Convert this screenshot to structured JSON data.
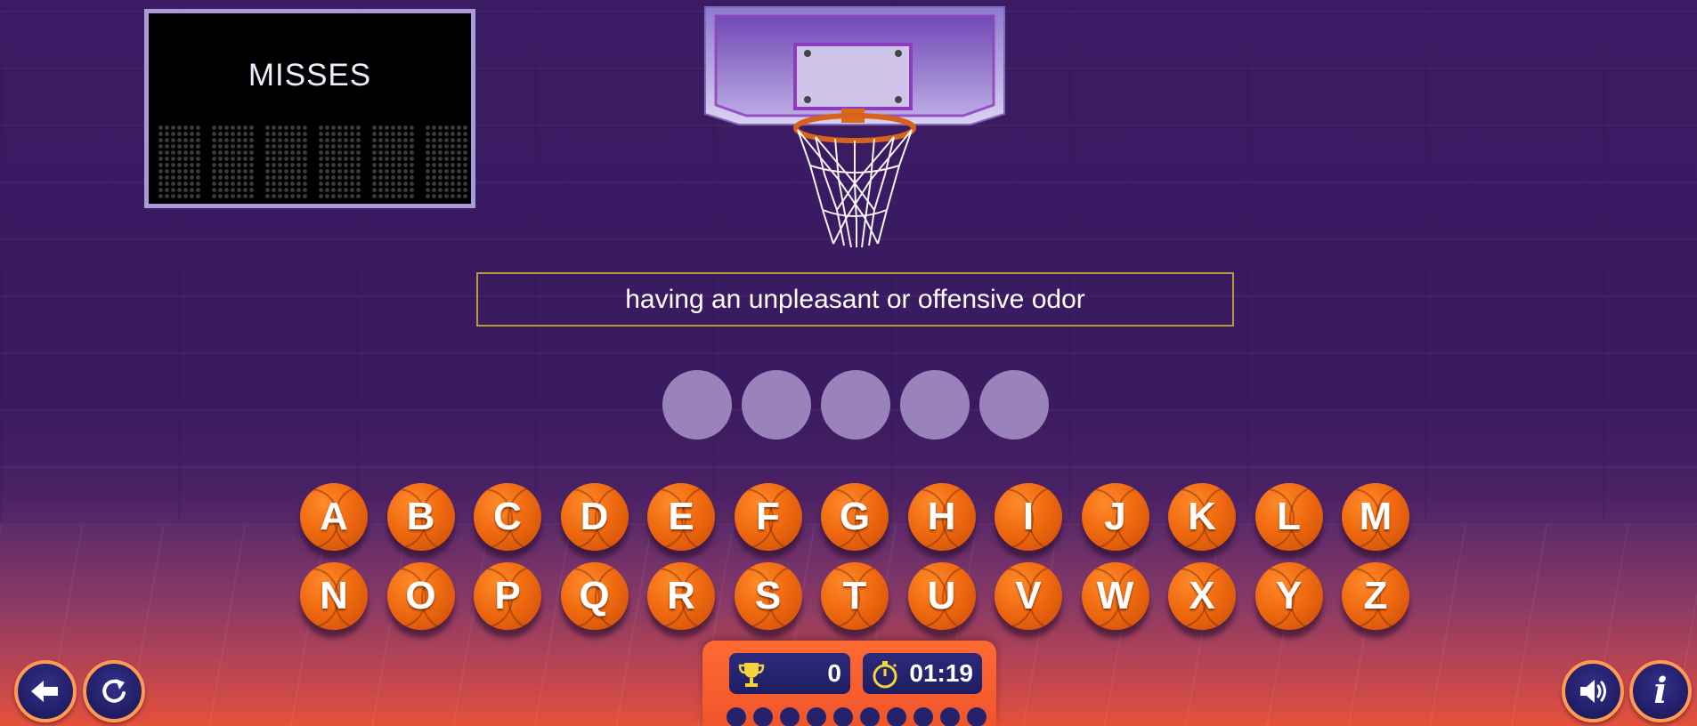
{
  "scoreboard": {
    "title": "MISSES",
    "miss_slots": 6
  },
  "clue": {
    "text": "having an unpleasant or offensive odor"
  },
  "answer": {
    "length": 5
  },
  "keyboard": {
    "row1": [
      "A",
      "B",
      "C",
      "D",
      "E",
      "F",
      "G",
      "H",
      "I",
      "J",
      "K",
      "L",
      "M"
    ],
    "row2": [
      "N",
      "O",
      "P",
      "Q",
      "R",
      "S",
      "T",
      "U",
      "V",
      "W",
      "X",
      "Y",
      "Z"
    ]
  },
  "status": {
    "score": "0",
    "timer": "01:19",
    "round_dots": 10
  },
  "icons": {
    "back": "arrow-left-icon",
    "restart": "restart-icon",
    "sound": "speaker-icon",
    "info": "info-icon",
    "score": "trophy-icon",
    "timer": "stopwatch-icon"
  },
  "colors": {
    "ball": "#f06a10",
    "answer_slot": "#9a83bb",
    "panel": "#f0552b",
    "status_box": "#1f1d63"
  }
}
